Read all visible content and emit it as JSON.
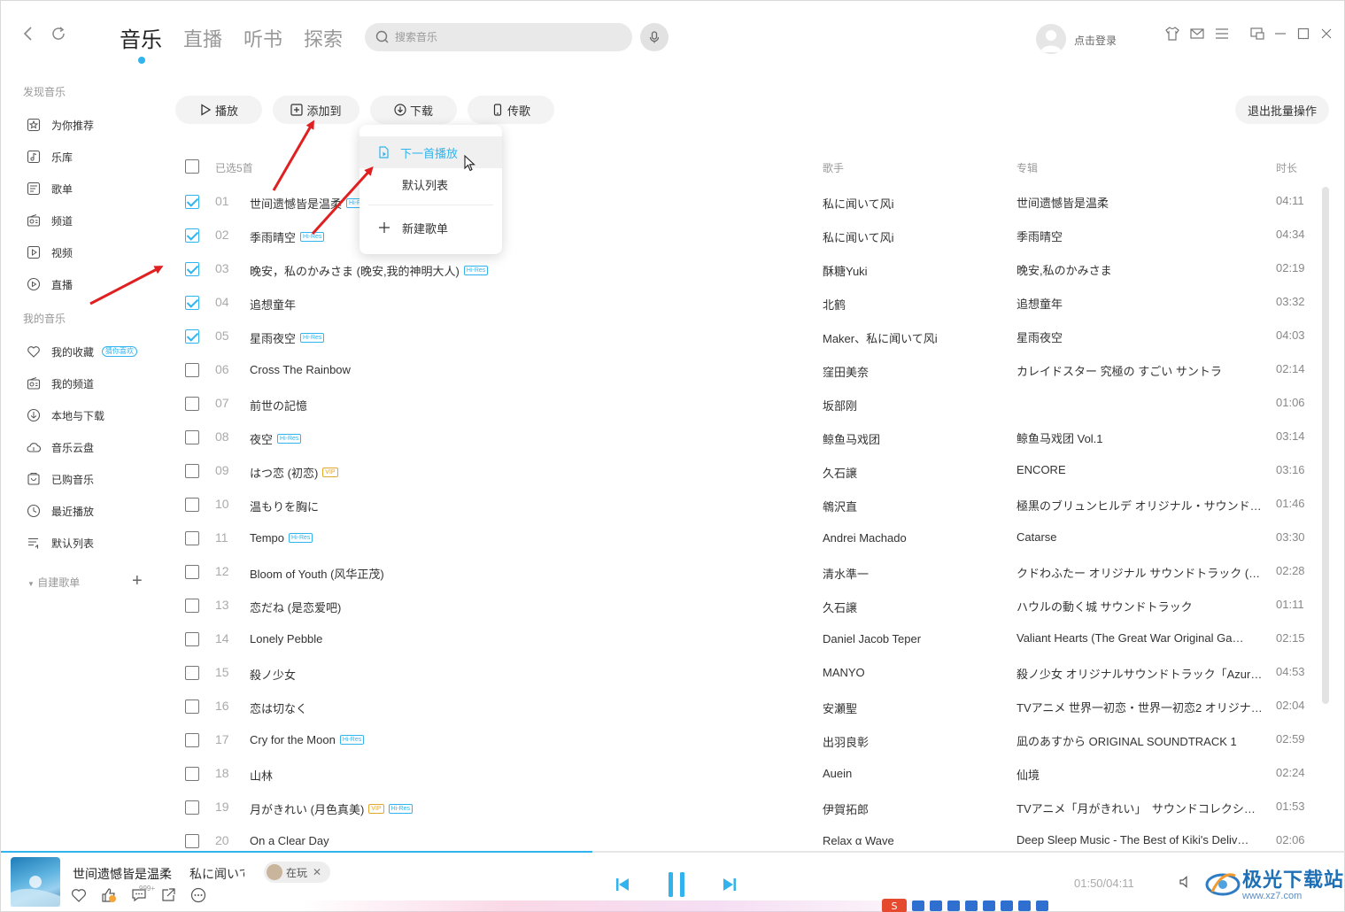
{
  "top": {
    "tabs": [
      "音乐",
      "直播",
      "听书",
      "探索"
    ],
    "active_tab": "音乐",
    "search_placeholder": "搜索音乐",
    "login_label": "点击登录"
  },
  "sidebar": {
    "discover_title": "发现音乐",
    "discover_items": [
      {
        "label": "为你推荐",
        "icon": "star-icon"
      },
      {
        "label": "乐库",
        "icon": "music-note-icon"
      },
      {
        "label": "歌单",
        "icon": "playlist-icon"
      },
      {
        "label": "频道",
        "icon": "radio-icon"
      },
      {
        "label": "视频",
        "icon": "video-icon"
      },
      {
        "label": "直播",
        "icon": "live-icon"
      }
    ],
    "my_title": "我的音乐",
    "my_items": [
      {
        "label": "我的收藏",
        "icon": "heart-icon",
        "badge": "猜你喜欢"
      },
      {
        "label": "我的频道",
        "icon": "radio-icon"
      },
      {
        "label": "本地与下载",
        "icon": "download-icon"
      },
      {
        "label": "音乐云盘",
        "icon": "cloud-icon"
      },
      {
        "label": "已购音乐",
        "icon": "purchased-icon"
      },
      {
        "label": "最近播放",
        "icon": "clock-icon"
      },
      {
        "label": "默认列表",
        "icon": "list-icon"
      }
    ],
    "created_title": "自建歌单",
    "add_label": "+"
  },
  "toolbar": {
    "play": "播放",
    "add_to": "添加到",
    "download": "下载",
    "transfer": "传歌",
    "exit_batch": "退出批量操作"
  },
  "dropdown": {
    "items": [
      "下一首播放",
      "默认列表",
      "新建歌单"
    ],
    "highlighted": "下一首播放"
  },
  "table": {
    "selected_label": "已选5首",
    "col_artist": "歌手",
    "col_album": "专辑",
    "col_duration": "时长",
    "rows": [
      {
        "num": "01",
        "title": "世间遗憾皆是温柔",
        "tags": [
          "Hi-Res"
        ],
        "artist": "私に闻いて风i",
        "album": "世间遗憾皆是温柔",
        "duration": "04:11",
        "checked": true
      },
      {
        "num": "02",
        "title": "季雨晴空",
        "tags": [
          "Hi-Res"
        ],
        "artist": "私に闻いて风i",
        "album": "季雨晴空",
        "duration": "04:34",
        "checked": true
      },
      {
        "num": "03",
        "title": "晚安，私のかみさま (晚安,我的神明大人)",
        "tags": [
          "Hi-Res"
        ],
        "artist": "酥糖Yuki",
        "album": "晚安,私のかみさま",
        "duration": "02:19",
        "checked": true
      },
      {
        "num": "04",
        "title": "追想童年",
        "tags": [],
        "artist": "北鹤",
        "album": "追想童年",
        "duration": "03:32",
        "checked": true
      },
      {
        "num": "05",
        "title": "星雨夜空",
        "tags": [
          "Hi-Res"
        ],
        "artist": "Maker、私に闻いて风i",
        "album": "星雨夜空",
        "duration": "04:03",
        "checked": true
      },
      {
        "num": "06",
        "title": "Cross The Rainbow",
        "tags": [],
        "artist": "窪田美奈",
        "album": "カレイドスター 究極の すごい サントラ",
        "duration": "02:14",
        "checked": false
      },
      {
        "num": "07",
        "title": "前世の記憶",
        "tags": [],
        "artist": "坂部刚",
        "album": "",
        "duration": "01:06",
        "checked": false
      },
      {
        "num": "08",
        "title": "夜空",
        "tags": [
          "Hi-Res"
        ],
        "artist": "鲸鱼马戏团",
        "album": "鲸鱼马戏团 Vol.1",
        "duration": "03:14",
        "checked": false
      },
      {
        "num": "09",
        "title": "はつ恋 (初恋)",
        "tags": [
          "VIP"
        ],
        "artist": "久石譲",
        "album": "ENCORE",
        "duration": "03:16",
        "checked": false
      },
      {
        "num": "10",
        "title": "温もりを胸に",
        "tags": [],
        "artist": "鴾沢直",
        "album": "極黒のブリュンヒルデ オリジナル・サウンド…",
        "duration": "01:46",
        "checked": false
      },
      {
        "num": "11",
        "title": "Tempo",
        "tags": [
          "Hi-Res"
        ],
        "artist": "Andrei Machado",
        "album": "Catarse",
        "duration": "03:30",
        "checked": false
      },
      {
        "num": "12",
        "title": "Bloom of Youth (风华正茂)",
        "tags": [],
        "artist": "清水準一",
        "album": "クドわふたー オリジナル サウンドトラック (…",
        "duration": "02:28",
        "checked": false
      },
      {
        "num": "13",
        "title": "恋だね (是恋爱吧)",
        "tags": [],
        "artist": "久石譲",
        "album": "ハウルの動く城 サウンドトラック",
        "duration": "01:11",
        "checked": false
      },
      {
        "num": "14",
        "title": "Lonely Pebble",
        "tags": [],
        "artist": "Daniel Jacob Teper",
        "album": "Valiant Hearts (The Great War Original Ga…",
        "duration": "02:15",
        "checked": false
      },
      {
        "num": "15",
        "title": "殺ノ少女",
        "tags": [],
        "artist": "MANYO",
        "album": "殺ノ少女 オリジナルサウンドトラック「Azur…",
        "duration": "04:53",
        "checked": false
      },
      {
        "num": "16",
        "title": "恋は切なく",
        "tags": [],
        "artist": "安瀬聖",
        "album": "TVアニメ 世界一初恋・世界一初恋2 オリジナ…",
        "duration": "02:04",
        "checked": false
      },
      {
        "num": "17",
        "title": "Cry for the Moon",
        "tags": [
          "Hi-Res"
        ],
        "artist": "出羽良彰",
        "album": "凪のあすから ORIGINAL SOUNDTRACK 1",
        "duration": "02:59",
        "checked": false
      },
      {
        "num": "18",
        "title": "山林",
        "tags": [],
        "artist": "Auein",
        "album": "仙境",
        "duration": "02:24",
        "checked": false
      },
      {
        "num": "19",
        "title": "月がきれい (月色真美)",
        "tags": [
          "VIP",
          "Hi-Res"
        ],
        "artist": "伊賀拓郎",
        "album": "TVアニメ「月がきれい」　サウンドコレクシ…",
        "duration": "01:53",
        "checked": false
      },
      {
        "num": "20",
        "title": "On a Clear Day",
        "tags": [],
        "artist": "Relax α Wave",
        "album": "Deep Sleep Music - The Best of Kiki's Deliv…",
        "duration": "02:06",
        "checked": false
      }
    ]
  },
  "player": {
    "title": "世间遗憾皆是温柔",
    "artist": "私に闻いて风i",
    "chip_label": "在玩",
    "comment_count": "999+",
    "time": "01:50/04:11",
    "progress_fraction": 0.44
  },
  "watermark": {
    "name": "极光下载站",
    "url": "www.xz7.com"
  },
  "colors": {
    "accent": "#31b4ee",
    "arrow": "#e02020",
    "vip": "#e3a72f"
  }
}
